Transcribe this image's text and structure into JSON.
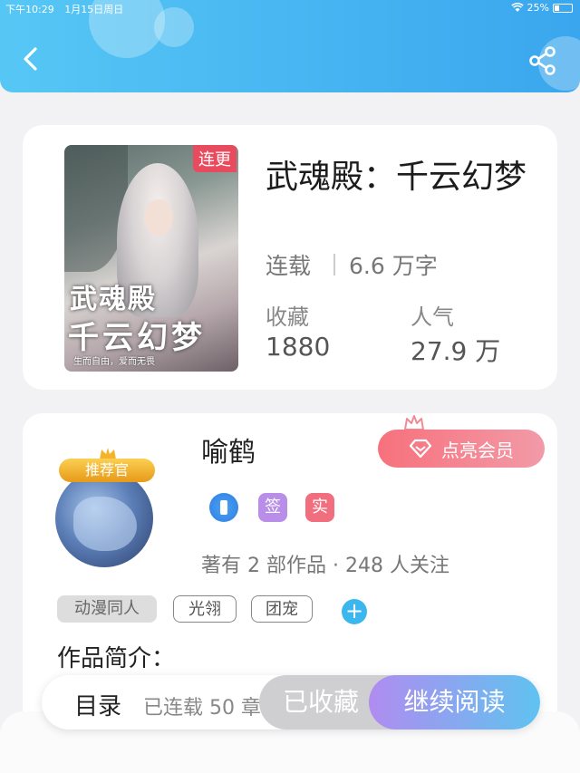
{
  "status_bar": {
    "time": "下午10:29",
    "date": "1月15日周日",
    "battery": "25%"
  },
  "header": {
    "back_icon": "chevron-left-icon",
    "share_icon": "share-icon"
  },
  "book": {
    "cover_badge": "连更",
    "cover_title_line1": "武魂殿",
    "cover_title_line2": "千云幻梦",
    "cover_caption": "生而自由，爱而无畏",
    "title": "武魂殿：千云幻梦",
    "status": "连载",
    "word_count": "6.6 万字",
    "favorites_label": "收藏",
    "favorites_value": "1880",
    "popularity_label": "人气",
    "popularity_value": "27.9 万"
  },
  "author": {
    "name": "喻鹤",
    "ribbon": "推荐官",
    "vip_button": "点亮会员",
    "badges": [
      {
        "text": "",
        "color": "#3d8ff0",
        "icon": "phone-badge-icon"
      },
      {
        "text": "签",
        "color": "#b88ee8"
      },
      {
        "text": "实",
        "color": "#f06e7e"
      }
    ],
    "meta": "著有 2 部作品 · 248 人关注"
  },
  "tags": [
    "动漫同人",
    "光翎",
    "团宠"
  ],
  "intro_title": "作品简介：",
  "bottom_bar": {
    "toc_label": "目录",
    "serial_status": "已连载 50 章",
    "collected_button": "已收藏",
    "continue_button": "继续阅读"
  },
  "colors": {
    "header_start": "#56c7f5",
    "header_end": "#3aa6ee",
    "accent_blue": "#3bb7ee",
    "vip_pink": "#f7717c",
    "cover_badge_red": "#e94b5e"
  }
}
